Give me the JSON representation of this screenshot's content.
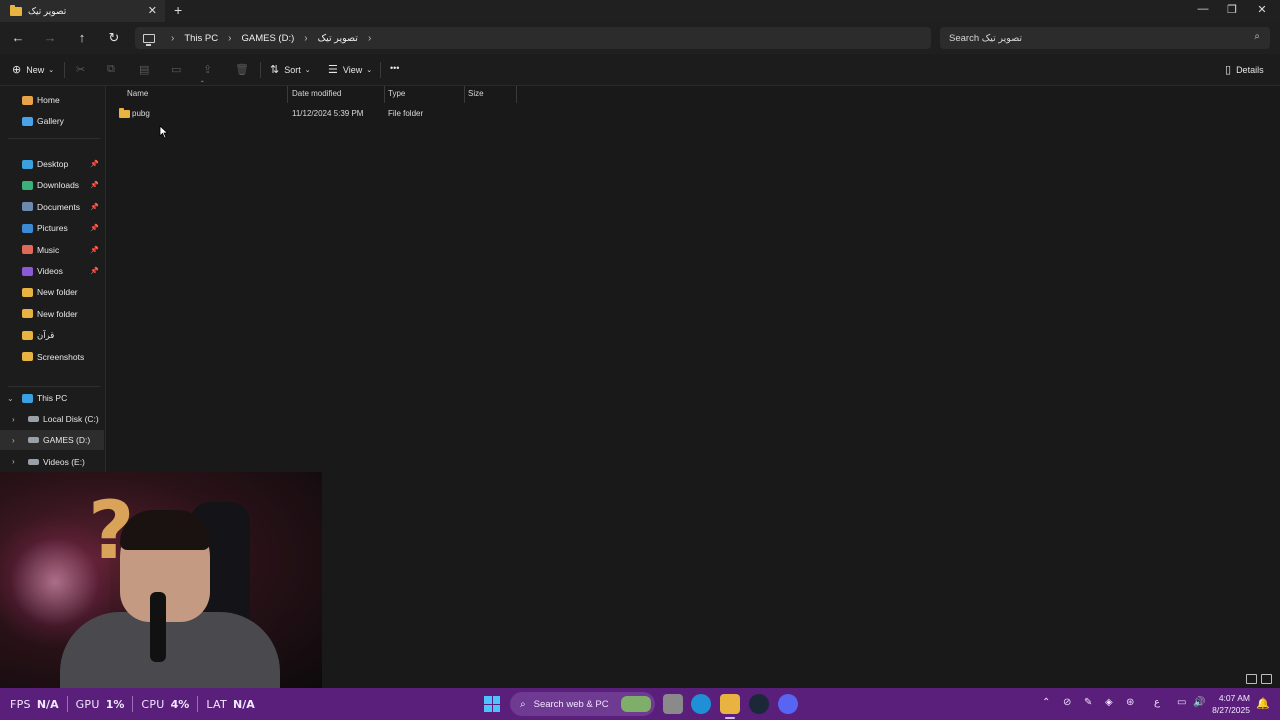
{
  "tab": {
    "title": "تصویر تیک",
    "close": "✕",
    "new": "+"
  },
  "window": {
    "minimize": "—",
    "maximize": "❐",
    "close": "✕"
  },
  "nav": {
    "back": "←",
    "forward": "→",
    "up": "↑",
    "refresh": "↻"
  },
  "breadcrumb": [
    "This PC",
    "GAMES (D:)",
    "تصویر تیک"
  ],
  "search": {
    "placeholder": "Search تصویر تیک",
    "icon": "search-icon"
  },
  "commands": {
    "new": "New",
    "sort": "Sort",
    "view": "View",
    "more": "•••",
    "details": "Details"
  },
  "sidebar": {
    "quick": [
      {
        "label": "Home",
        "color": "#e8a24a"
      },
      {
        "label": "Gallery",
        "color": "#4aa3e8"
      }
    ],
    "pinned": [
      {
        "label": "Desktop",
        "color": "#3aa0e0",
        "pinned": true
      },
      {
        "label": "Downloads",
        "color": "#3bb07a",
        "pinned": true
      },
      {
        "label": "Documents",
        "color": "#6c8ab0",
        "pinned": true
      },
      {
        "label": "Pictures",
        "color": "#3a8ad6",
        "pinned": true
      },
      {
        "label": "Music",
        "color": "#e06a5a",
        "pinned": true
      },
      {
        "label": "Videos",
        "color": "#8b5ad6",
        "pinned": true
      },
      {
        "label": "New folder",
        "color": "#e9b341",
        "pinned": false
      },
      {
        "label": "New folder",
        "color": "#e9b341",
        "pinned": false
      },
      {
        "label": "قرآن",
        "color": "#e9b341",
        "pinned": false
      },
      {
        "label": "Screenshots",
        "color": "#e9b341",
        "pinned": false
      }
    ],
    "thispc": {
      "label": "This PC",
      "color": "#3aa0e0"
    },
    "drives": [
      {
        "label": "Local Disk (C:)",
        "selected": false
      },
      {
        "label": "GAMES (D:)",
        "selected": true
      },
      {
        "label": "Videos (E:)",
        "selected": false
      }
    ]
  },
  "columns": [
    "Name",
    "Date modified",
    "Type",
    "Size"
  ],
  "files": [
    {
      "name": "pubg",
      "date": "11/12/2024 5:39 PM",
      "type": "File folder",
      "size": ""
    }
  ],
  "overlay": {
    "fps_label": "FPS",
    "fps_value": "N/A",
    "gpu_label": "GPU",
    "gpu_value": "1%",
    "cpu_label": "CPU",
    "cpu_value": "4%",
    "lat_label": "LAT",
    "lat_value": "N/A"
  },
  "taskbar": {
    "search_placeholder": "Search web & PC",
    "time": "4:07 AM",
    "date": "8/27/2025",
    "lang": "ع"
  }
}
